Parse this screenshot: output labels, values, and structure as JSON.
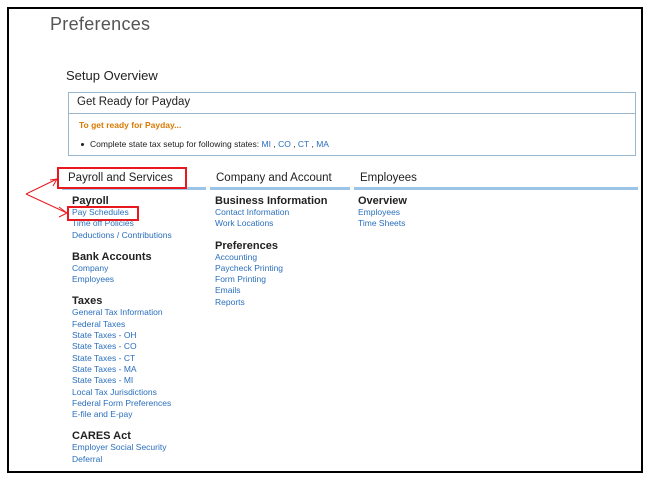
{
  "page": {
    "title": "Preferences",
    "section_title": "Setup Overview"
  },
  "ready": {
    "header": "Get Ready for Payday",
    "subheading": "To get ready for Payday...",
    "bullet_text": "Complete state tax setup for following states:",
    "states": [
      "MI",
      "CO",
      "CT",
      "MA"
    ]
  },
  "tabs": [
    {
      "label": "Payroll and Services"
    },
    {
      "label": "Company and Account"
    },
    {
      "label": "Employees"
    }
  ],
  "columns": {
    "payroll_services": [
      {
        "heading": "Payroll",
        "links": [
          "Pay Schedules",
          "Time off Policies",
          "Deductions / Contributions"
        ]
      },
      {
        "heading": "Bank Accounts",
        "links": [
          "Company",
          "Employees"
        ]
      },
      {
        "heading": "Taxes",
        "links": [
          "General Tax Information",
          "Federal Taxes",
          "State Taxes - OH",
          "State Taxes - CO",
          "State Taxes - CT",
          "State Taxes - MA",
          "State Taxes - MI",
          "Local Tax Jurisdictions",
          "Federal Form Preferences",
          "E-file and E-pay"
        ]
      },
      {
        "heading": "CARES Act",
        "links": [
          "Employer Social Security",
          "Deferral"
        ]
      }
    ],
    "company_account": [
      {
        "heading": "Business Information",
        "links": [
          "Contact Information",
          "Work Locations"
        ]
      },
      {
        "heading": "Preferences",
        "links": [
          "Accounting",
          "Paycheck Printing",
          "Form Printing",
          "Emails",
          "Reports"
        ]
      }
    ],
    "employees": [
      {
        "heading": "Overview",
        "links": [
          "Employees",
          "Time Sheets"
        ]
      }
    ]
  },
  "annotation_colors": {
    "highlight": "#e8191e",
    "tab_underline": "#9bc4e6",
    "link": "#2a6fbd",
    "subheading": "#d97a00"
  }
}
